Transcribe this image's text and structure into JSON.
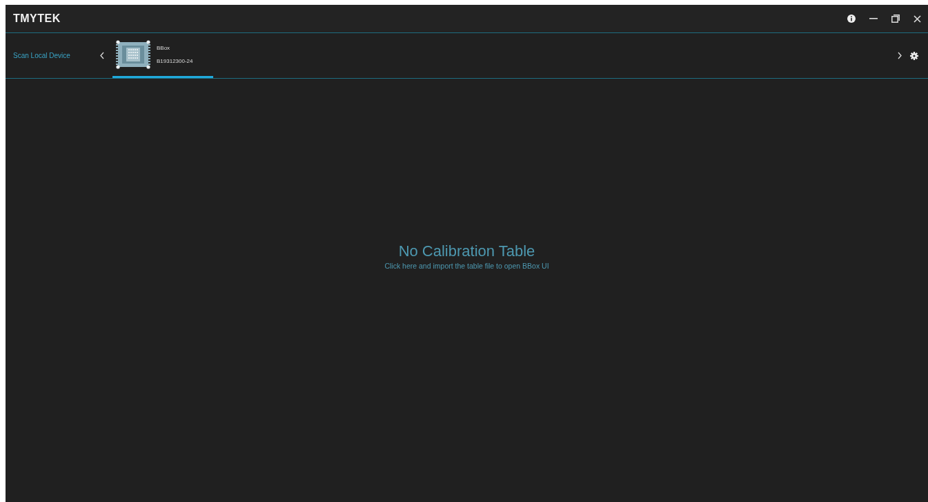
{
  "window": {
    "title": "TMYTEK"
  },
  "device_bar": {
    "scan_label": "Scan Local Device",
    "devices": [
      {
        "name": "BBox",
        "serial": "B19312300-24",
        "selected": true
      }
    ]
  },
  "main": {
    "heading": "No Calibration Table",
    "hint": "Click here and import the table file to open BBox UI"
  }
}
